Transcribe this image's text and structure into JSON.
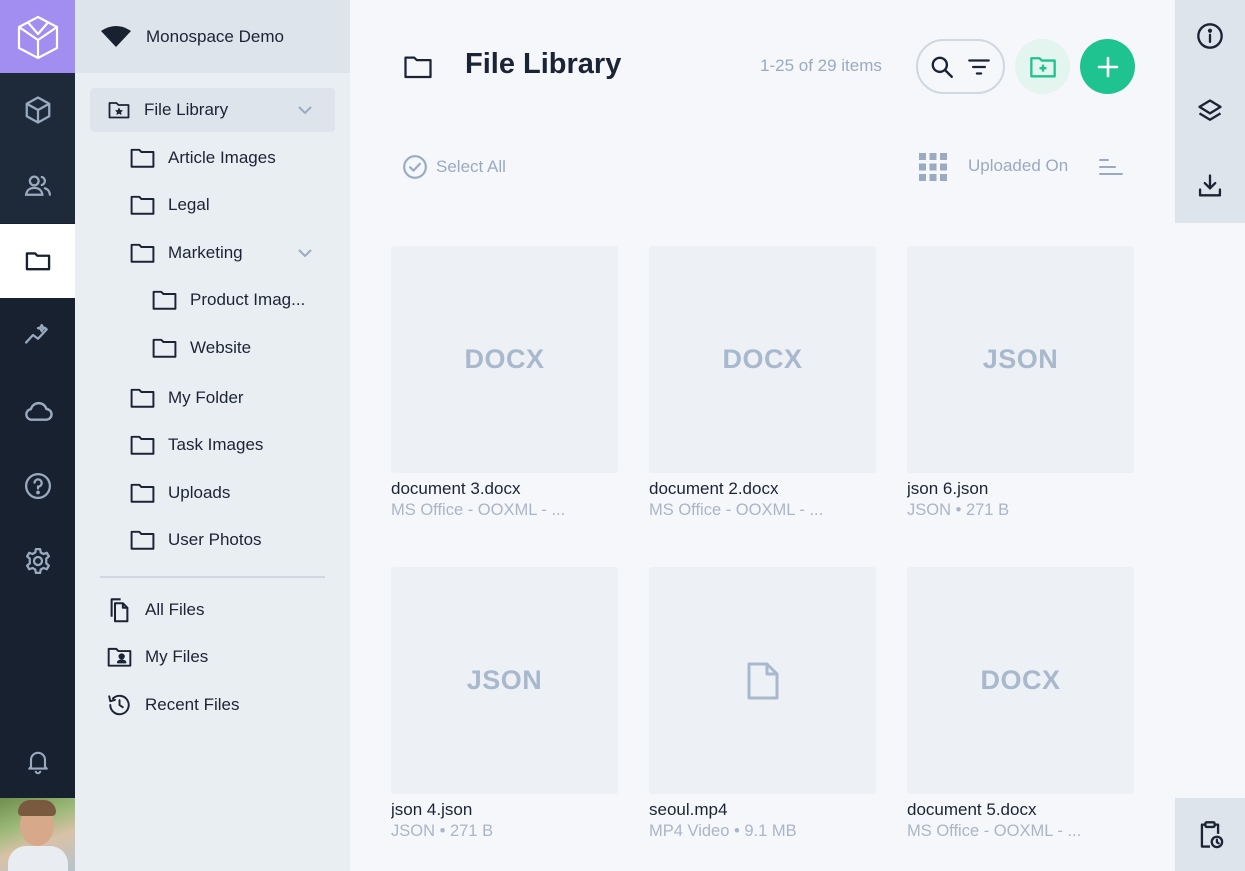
{
  "workspace": {
    "name": "Monospace Demo"
  },
  "rail": {
    "items": [
      "logo-icon",
      "cube-icon",
      "users-icon",
      "folder-icon",
      "insights-icon",
      "cloud-icon",
      "help-icon",
      "settings-icon",
      "bell-icon"
    ],
    "active": "folder-icon"
  },
  "sidebar": {
    "library_label": "File Library",
    "folders": [
      {
        "label": "Article Images"
      },
      {
        "label": "Legal"
      },
      {
        "label": "Marketing"
      },
      {
        "label": "Product Imag..."
      },
      {
        "label": "Website"
      },
      {
        "label": "My Folder"
      },
      {
        "label": "Task Images"
      },
      {
        "label": "Uploads"
      },
      {
        "label": "User Photos"
      }
    ],
    "shortcuts": [
      {
        "label": "All Files"
      },
      {
        "label": "My Files"
      },
      {
        "label": "Recent Files"
      }
    ]
  },
  "header": {
    "title": "File Library",
    "count": "1-25 of 29 items"
  },
  "toolbar": {
    "select_all": "Select All",
    "sort_label": "Uploaded On"
  },
  "files": [
    {
      "thumb": "DOCX",
      "name": "document 3.docx",
      "meta": "MS Office - OOXML - ..."
    },
    {
      "thumb": "DOCX",
      "name": "document 2.docx",
      "meta": "MS Office - OOXML - ..."
    },
    {
      "thumb": "JSON",
      "name": "json 6.json",
      "meta": "JSON • 271 B"
    },
    {
      "thumb": "JSON",
      "name": "json 4.json",
      "meta": "JSON • 271 B"
    },
    {
      "thumb": "",
      "name": "seoul.mp4",
      "meta": "MP4 Video • 9.1 MB"
    },
    {
      "thumb": "DOCX",
      "name": "document 5.docx",
      "meta": "MS Office - OOXML - ..."
    }
  ],
  "colors": {
    "accent": "#1fc38f",
    "logo_bg": "#a18ef0",
    "rail_bg": "#18212f"
  }
}
